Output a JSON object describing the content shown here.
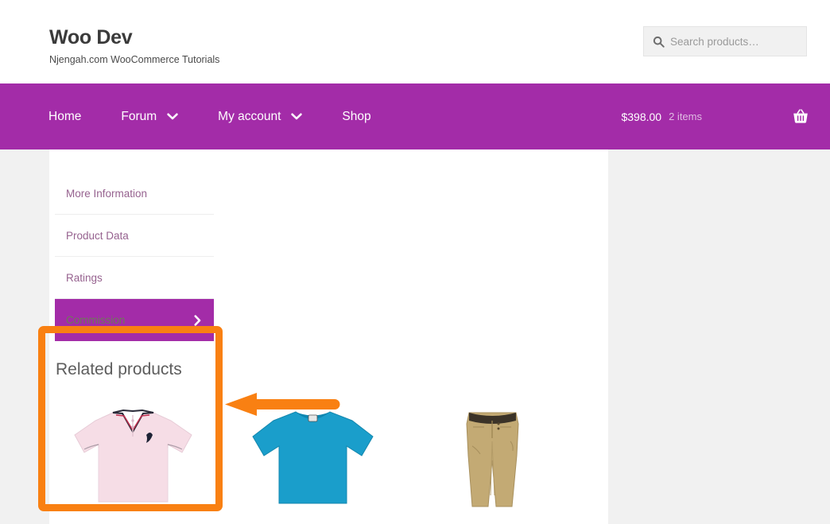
{
  "header": {
    "site_title": "Woo Dev",
    "tagline": "Njengah.com WooCommerce Tutorials",
    "search": {
      "placeholder": "Search products…",
      "value": "",
      "icon": "search-icon"
    }
  },
  "nav": {
    "items": [
      {
        "label": "Home",
        "has_dropdown": false
      },
      {
        "label": "Forum",
        "has_dropdown": true
      },
      {
        "label": "My account",
        "has_dropdown": true
      },
      {
        "label": "Shop",
        "has_dropdown": false
      }
    ],
    "cart": {
      "amount": "$398.00",
      "count": "2 items",
      "icon": "shopping-basket-icon"
    },
    "background_color": "#a32ca8"
  },
  "product_tabs": {
    "items": [
      {
        "label": "More Information",
        "active": false
      },
      {
        "label": "Product Data",
        "active": false
      },
      {
        "label": "Ratings",
        "active": false
      },
      {
        "label": "Commission",
        "active": true,
        "icon": "chevron-right-icon"
      }
    ],
    "active_background_color": "#a32ca8",
    "inactive_text_color": "#96628f"
  },
  "annotations": {
    "color": "#f98012",
    "highlight_box_target": "product-tabs",
    "arrow_direction": "left"
  },
  "related": {
    "heading": "Related products",
    "products": [
      {
        "name": "pink-polo-shirt",
        "primary_color": "#f3d9e2"
      },
      {
        "name": "blue-tshirt",
        "primary_color": "#1f9fc9"
      },
      {
        "name": "khaki-pants",
        "primary_color": "#c0a875"
      }
    ]
  }
}
